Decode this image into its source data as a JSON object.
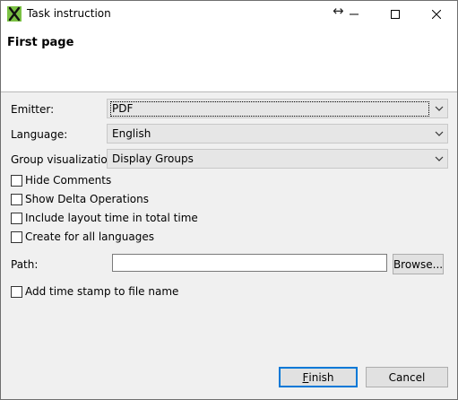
{
  "window": {
    "title": "Task instruction",
    "resize_symbol": "↔"
  },
  "header": {
    "page_title": "First page"
  },
  "form": {
    "emitter": {
      "label": "Emitter:",
      "value": "PDF"
    },
    "language": {
      "label": "Language:",
      "value": "English"
    },
    "group_visualization": {
      "label": "Group visualization:",
      "value": "Display Groups"
    },
    "checkboxes": [
      {
        "label": "Hide Comments",
        "checked": false
      },
      {
        "label": "Show Delta Operations",
        "checked": false
      },
      {
        "label": "Include layout time in total time",
        "checked": false
      },
      {
        "label": "Create for all languages",
        "checked": false
      }
    ],
    "path": {
      "label": "Path:",
      "value": "",
      "browse_label": "Browse..."
    },
    "timestamp": {
      "label": "Add time stamp to file name",
      "checked": false
    }
  },
  "footer": {
    "finish_first_letter": "F",
    "finish_rest": "inish",
    "cancel_label": "Cancel"
  },
  "colors": {
    "accent": "#0078d7",
    "app_icon_green": "#7ac143"
  }
}
